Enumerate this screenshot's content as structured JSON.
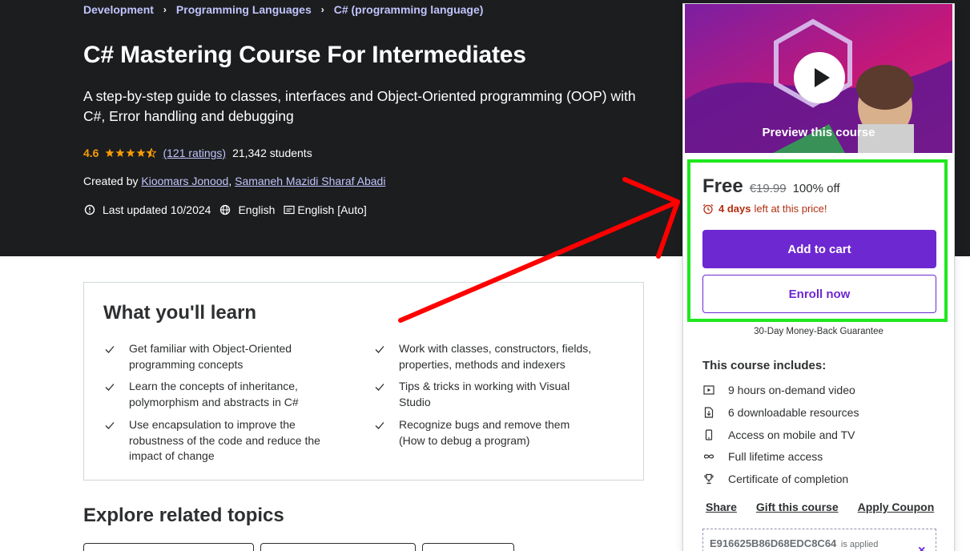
{
  "breadcrumb": {
    "items": [
      "Development",
      "Programming Languages",
      "C# (programming language)"
    ],
    "separator": "›"
  },
  "course": {
    "title": "C# Mastering Course For Intermediates",
    "subtitle": "A step-by-step guide to classes, interfaces and Object-Oriented programming (OOP) with C#, Error handling and debugging",
    "rating": "4.6",
    "rating_stars": 4.6,
    "ratings_count": "(121 ratings)",
    "students": "21,342 students",
    "created_by_label": "Created by",
    "instructors": [
      "Kioomars Jonood",
      "Samaneh Mazidi Sharaf Abadi"
    ],
    "instructor_separator": ",",
    "last_updated": "Last updated 10/2024",
    "language": "English",
    "captions": "English [Auto]"
  },
  "learn": {
    "title": "What you'll learn",
    "items": [
      "Get familiar with Object-Oriented programming concepts",
      "Work with classes, constructors, fields, properties, methods and indexers",
      "Learn the concepts of inheritance, polymorphism and abstracts in C#",
      "Tips & tricks in working with Visual Studio",
      "Use encapsulation to improve the robustness of the code and reduce the impact of change",
      "Recognize bugs and remove them (How to debug a program)"
    ]
  },
  "explore": {
    "title": "Explore related topics"
  },
  "sidebar": {
    "preview_label": "Preview this course",
    "price": "Free",
    "original_price": "€19.99",
    "discount": "100% off",
    "timer_bold": "4 days",
    "timer_rest": "left at this price!",
    "add_to_cart": "Add to cart",
    "enroll_now": "Enroll now",
    "guarantee": "30-Day Money-Back Guarantee",
    "includes_title": "This course includes:",
    "includes": [
      {
        "icon": "video-icon",
        "label": "9 hours on-demand video"
      },
      {
        "icon": "file-download-icon",
        "label": "6 downloadable resources"
      },
      {
        "icon": "mobile-icon",
        "label": "Access on mobile and TV"
      },
      {
        "icon": "infinity-icon",
        "label": "Full lifetime access"
      },
      {
        "icon": "trophy-icon",
        "label": "Certificate of completion"
      }
    ],
    "links": [
      "Share",
      "Gift this course",
      "Apply Coupon"
    ],
    "coupon_code": "E916625B86D68EDC8C64",
    "coupon_note": "is applied",
    "coupon_close": "×"
  },
  "colors": {
    "hero_bg": "#1c1d1f",
    "accent_purple": "#6d28d2",
    "link_purple": "#c0c4fc",
    "rating_orange": "#f69c08",
    "timer_red": "#b32d0f",
    "annotation_red": "#ff0000",
    "annotation_green": "#1ee81e"
  }
}
